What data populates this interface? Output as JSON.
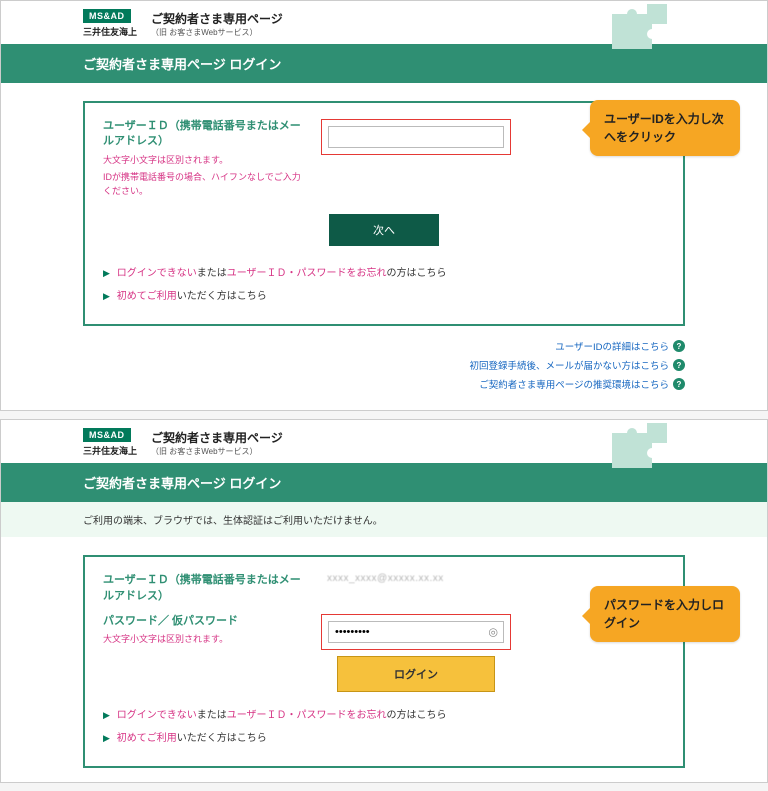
{
  "logo": {
    "badge": "MS&AD",
    "sub": "三井住友海上"
  },
  "page_title": {
    "main": "ご契約者さま専用ページ",
    "sub": "（旧 お客さまWebサービス）"
  },
  "green_header": "ご契約者さま専用ページ ログイン",
  "shot1": {
    "user_id_label": "ユーザーＩＤ（携帯電話番号またはメールアドレス）",
    "hint1": "大文字小文字は区別されます。",
    "hint2": "IDが携帯電話番号の場合、ハイフンなしでご入力ください。",
    "next_btn": "次へ",
    "help1_a": "ログインできない",
    "help1_b": "または",
    "help1_c": "ユーザーＩＤ・パスワードをお忘れ",
    "help1_d": "の方はこちら",
    "help2_a": "初めてご利用",
    "help2_b": "いただく方はこちら",
    "info1": "ユーザーIDの詳細はこちら",
    "info2": "初回登録手続後、メールが届かない方はこちら",
    "info3": "ご契約者さま専用ページの推奨環境はこちら",
    "callout": "ユーザーIDを入力し次へをクリック"
  },
  "shot2": {
    "notice": "ご利用の端末、ブラウザでは、生体認証はご利用いただけません。",
    "user_id_label": "ユーザーＩＤ（携帯電話番号またはメールアドレス）",
    "user_id_value": "xxxx_xxxx@xxxxx.xx.xx",
    "pw_label": "パスワード／ 仮パスワード",
    "pw_hint": "大文字小文字は区別されます。",
    "pw_value": "•••••••••",
    "login_btn": "ログイン",
    "help1_a": "ログインできない",
    "help1_b": "または",
    "help1_c": "ユーザーＩＤ・パスワードをお忘れ",
    "help1_d": "の方はこちら",
    "help2_a": "初めてご利用",
    "help2_b": "いただく方はこちら",
    "callout": "パスワードを入力しログイン"
  }
}
